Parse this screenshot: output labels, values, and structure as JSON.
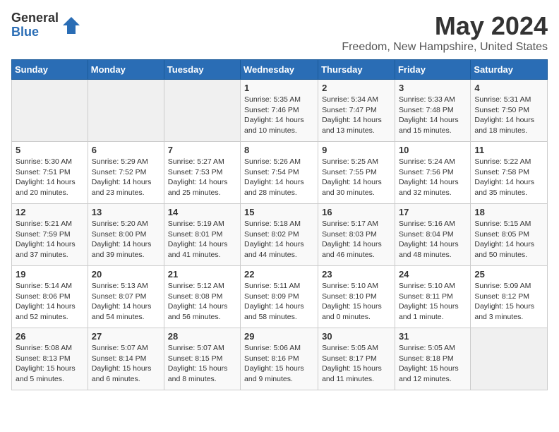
{
  "logo": {
    "general": "General",
    "blue": "Blue"
  },
  "title": "May 2024",
  "location": "Freedom, New Hampshire, United States",
  "headers": [
    "Sunday",
    "Monday",
    "Tuesday",
    "Wednesday",
    "Thursday",
    "Friday",
    "Saturday"
  ],
  "weeks": [
    [
      {
        "day": "",
        "detail": ""
      },
      {
        "day": "",
        "detail": ""
      },
      {
        "day": "",
        "detail": ""
      },
      {
        "day": "1",
        "detail": "Sunrise: 5:35 AM\nSunset: 7:46 PM\nDaylight: 14 hours\nand 10 minutes."
      },
      {
        "day": "2",
        "detail": "Sunrise: 5:34 AM\nSunset: 7:47 PM\nDaylight: 14 hours\nand 13 minutes."
      },
      {
        "day": "3",
        "detail": "Sunrise: 5:33 AM\nSunset: 7:48 PM\nDaylight: 14 hours\nand 15 minutes."
      },
      {
        "day": "4",
        "detail": "Sunrise: 5:31 AM\nSunset: 7:50 PM\nDaylight: 14 hours\nand 18 minutes."
      }
    ],
    [
      {
        "day": "5",
        "detail": "Sunrise: 5:30 AM\nSunset: 7:51 PM\nDaylight: 14 hours\nand 20 minutes."
      },
      {
        "day": "6",
        "detail": "Sunrise: 5:29 AM\nSunset: 7:52 PM\nDaylight: 14 hours\nand 23 minutes."
      },
      {
        "day": "7",
        "detail": "Sunrise: 5:27 AM\nSunset: 7:53 PM\nDaylight: 14 hours\nand 25 minutes."
      },
      {
        "day": "8",
        "detail": "Sunrise: 5:26 AM\nSunset: 7:54 PM\nDaylight: 14 hours\nand 28 minutes."
      },
      {
        "day": "9",
        "detail": "Sunrise: 5:25 AM\nSunset: 7:55 PM\nDaylight: 14 hours\nand 30 minutes."
      },
      {
        "day": "10",
        "detail": "Sunrise: 5:24 AM\nSunset: 7:56 PM\nDaylight: 14 hours\nand 32 minutes."
      },
      {
        "day": "11",
        "detail": "Sunrise: 5:22 AM\nSunset: 7:58 PM\nDaylight: 14 hours\nand 35 minutes."
      }
    ],
    [
      {
        "day": "12",
        "detail": "Sunrise: 5:21 AM\nSunset: 7:59 PM\nDaylight: 14 hours\nand 37 minutes."
      },
      {
        "day": "13",
        "detail": "Sunrise: 5:20 AM\nSunset: 8:00 PM\nDaylight: 14 hours\nand 39 minutes."
      },
      {
        "day": "14",
        "detail": "Sunrise: 5:19 AM\nSunset: 8:01 PM\nDaylight: 14 hours\nand 41 minutes."
      },
      {
        "day": "15",
        "detail": "Sunrise: 5:18 AM\nSunset: 8:02 PM\nDaylight: 14 hours\nand 44 minutes."
      },
      {
        "day": "16",
        "detail": "Sunrise: 5:17 AM\nSunset: 8:03 PM\nDaylight: 14 hours\nand 46 minutes."
      },
      {
        "day": "17",
        "detail": "Sunrise: 5:16 AM\nSunset: 8:04 PM\nDaylight: 14 hours\nand 48 minutes."
      },
      {
        "day": "18",
        "detail": "Sunrise: 5:15 AM\nSunset: 8:05 PM\nDaylight: 14 hours\nand 50 minutes."
      }
    ],
    [
      {
        "day": "19",
        "detail": "Sunrise: 5:14 AM\nSunset: 8:06 PM\nDaylight: 14 hours\nand 52 minutes."
      },
      {
        "day": "20",
        "detail": "Sunrise: 5:13 AM\nSunset: 8:07 PM\nDaylight: 14 hours\nand 54 minutes."
      },
      {
        "day": "21",
        "detail": "Sunrise: 5:12 AM\nSunset: 8:08 PM\nDaylight: 14 hours\nand 56 minutes."
      },
      {
        "day": "22",
        "detail": "Sunrise: 5:11 AM\nSunset: 8:09 PM\nDaylight: 14 hours\nand 58 minutes."
      },
      {
        "day": "23",
        "detail": "Sunrise: 5:10 AM\nSunset: 8:10 PM\nDaylight: 15 hours\nand 0 minutes."
      },
      {
        "day": "24",
        "detail": "Sunrise: 5:10 AM\nSunset: 8:11 PM\nDaylight: 15 hours\nand 1 minute."
      },
      {
        "day": "25",
        "detail": "Sunrise: 5:09 AM\nSunset: 8:12 PM\nDaylight: 15 hours\nand 3 minutes."
      }
    ],
    [
      {
        "day": "26",
        "detail": "Sunrise: 5:08 AM\nSunset: 8:13 PM\nDaylight: 15 hours\nand 5 minutes."
      },
      {
        "day": "27",
        "detail": "Sunrise: 5:07 AM\nSunset: 8:14 PM\nDaylight: 15 hours\nand 6 minutes."
      },
      {
        "day": "28",
        "detail": "Sunrise: 5:07 AM\nSunset: 8:15 PM\nDaylight: 15 hours\nand 8 minutes."
      },
      {
        "day": "29",
        "detail": "Sunrise: 5:06 AM\nSunset: 8:16 PM\nDaylight: 15 hours\nand 9 minutes."
      },
      {
        "day": "30",
        "detail": "Sunrise: 5:05 AM\nSunset: 8:17 PM\nDaylight: 15 hours\nand 11 minutes."
      },
      {
        "day": "31",
        "detail": "Sunrise: 5:05 AM\nSunset: 8:18 PM\nDaylight: 15 hours\nand 12 minutes."
      },
      {
        "day": "",
        "detail": ""
      }
    ]
  ]
}
